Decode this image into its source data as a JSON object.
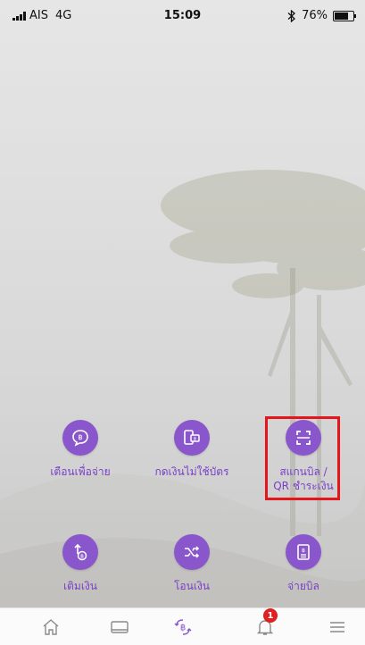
{
  "status": {
    "carrier": "AIS",
    "network": "4G",
    "time": "15:09",
    "bluetooth_icon": "bluetooth-icon",
    "battery": "76%",
    "battery_level": 0.76
  },
  "actions": [
    {
      "label": "เตือนเพื่อจ่าย",
      "icon": "baht-reminder-icon"
    },
    {
      "label": "กดเงินไม่ใช้บัตร",
      "icon": "cardless-withdraw-icon"
    },
    {
      "label_line1": "สแกนบิล /",
      "label_line2": "QR ชำระเงิน",
      "icon": "scan-qr-icon"
    },
    {
      "label": "เติมเงิน",
      "icon": "topup-icon"
    },
    {
      "label": "โอนเงิน",
      "icon": "transfer-icon"
    },
    {
      "label": "จ่ายบิล",
      "icon": "pay-bill-icon"
    }
  ],
  "tabbar": {
    "items": [
      "home-icon",
      "wallet-icon",
      "baht-exchange-icon",
      "notification-bell-icon",
      "menu-icon"
    ],
    "notification_count": "1"
  },
  "colors": {
    "accent": "#8a56cc",
    "label": "#7a3fc6",
    "highlight": "#e5151c",
    "badge": "#e02020"
  }
}
